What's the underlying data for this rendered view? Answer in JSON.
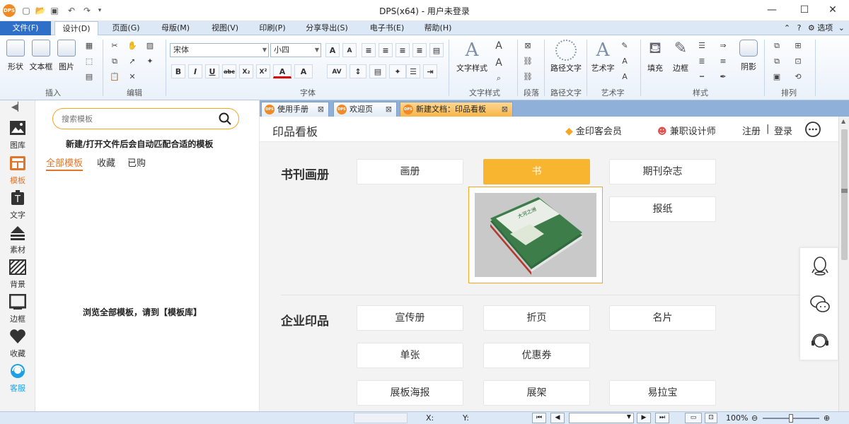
{
  "window": {
    "title": "DPS(x64) - 用户未登录",
    "logo_text": "DPS",
    "minimize": "—",
    "maximize": "☐",
    "close": "✕"
  },
  "menubar": {
    "items": [
      "文件(F)",
      "设计(D)",
      "页面(G)",
      "母版(M)",
      "视图(V)",
      "印刷(P)",
      "分享导出(S)",
      "电子书(E)",
      "帮助(H)"
    ],
    "active": "设计(D)",
    "options_label": "选项"
  },
  "ribbon": {
    "groups": {
      "insert": {
        "label": "插入",
        "buttons": [
          "形状",
          "文本框",
          "图片"
        ]
      },
      "edit": {
        "label": "编辑"
      },
      "font": {
        "label": "字体",
        "font_name": "宋体",
        "font_size": "小四"
      },
      "text_style": {
        "label": "文字样式",
        "button": "文字样式"
      },
      "paragraph": {
        "label": "段落"
      },
      "path_text": {
        "label": "路径文字",
        "button": "路径文字"
      },
      "art_text": {
        "label": "艺术字",
        "button": "艺术字"
      },
      "style": {
        "label": "样式",
        "buttons": [
          "填充",
          "边框",
          "阴影"
        ]
      },
      "arrange": {
        "label": "排列"
      }
    },
    "format_buttons": [
      "B",
      "I",
      "U",
      "abc",
      "X₂",
      "X²",
      "A",
      "A"
    ]
  },
  "leftstrip": {
    "items": [
      {
        "label": "图库",
        "icon": "image-icon"
      },
      {
        "label": "模板",
        "icon": "template-icon"
      },
      {
        "label": "文字",
        "icon": "text-icon"
      },
      {
        "label": "素材",
        "icon": "material-icon"
      },
      {
        "label": "背景",
        "icon": "background-icon"
      },
      {
        "label": "边框",
        "icon": "border-icon"
      },
      {
        "label": "收藏",
        "icon": "heart-icon"
      },
      {
        "label": "客服",
        "icon": "service-icon"
      }
    ],
    "active": "模板"
  },
  "template_panel": {
    "search_placeholder": "搜索模板",
    "hint_top": "新建/打开文件后会自动匹配合适的模板",
    "tabs": [
      "全部模板",
      "收藏",
      "已购"
    ],
    "hint_bottom": "浏览全部模板，请到【模板库】"
  },
  "doc_tabs": [
    {
      "label": "使用手册",
      "active": false
    },
    {
      "label": "欢迎页",
      "active": false
    },
    {
      "label": "新建文档：印品看板",
      "active": true
    }
  ],
  "main": {
    "page_title": "印品看板",
    "header_links": {
      "vip": "金印客会员",
      "designer": "兼职设计师",
      "register": "注册",
      "sep": "|",
      "login": "登录"
    },
    "sections": [
      {
        "title": "书刊画册",
        "items": [
          "画册",
          "书",
          "期刊杂志",
          "报纸"
        ],
        "active": "书"
      },
      {
        "title": "企业印品",
        "items": [
          "宣传册",
          "折页",
          "名片",
          "单张",
          "优惠券",
          "展板海报",
          "展架",
          "易拉宝"
        ]
      }
    ],
    "preview_book_title": "大河之洲"
  },
  "statusbar": {
    "x_label": "X:",
    "y_label": "Y:",
    "zoom": "100%",
    "zoom_fraction": 0.5
  },
  "colors": {
    "accent_orange": "#f8b530",
    "menu_blue": "#2f6fc8",
    "ribbon_bg": "#eaf1fa"
  }
}
